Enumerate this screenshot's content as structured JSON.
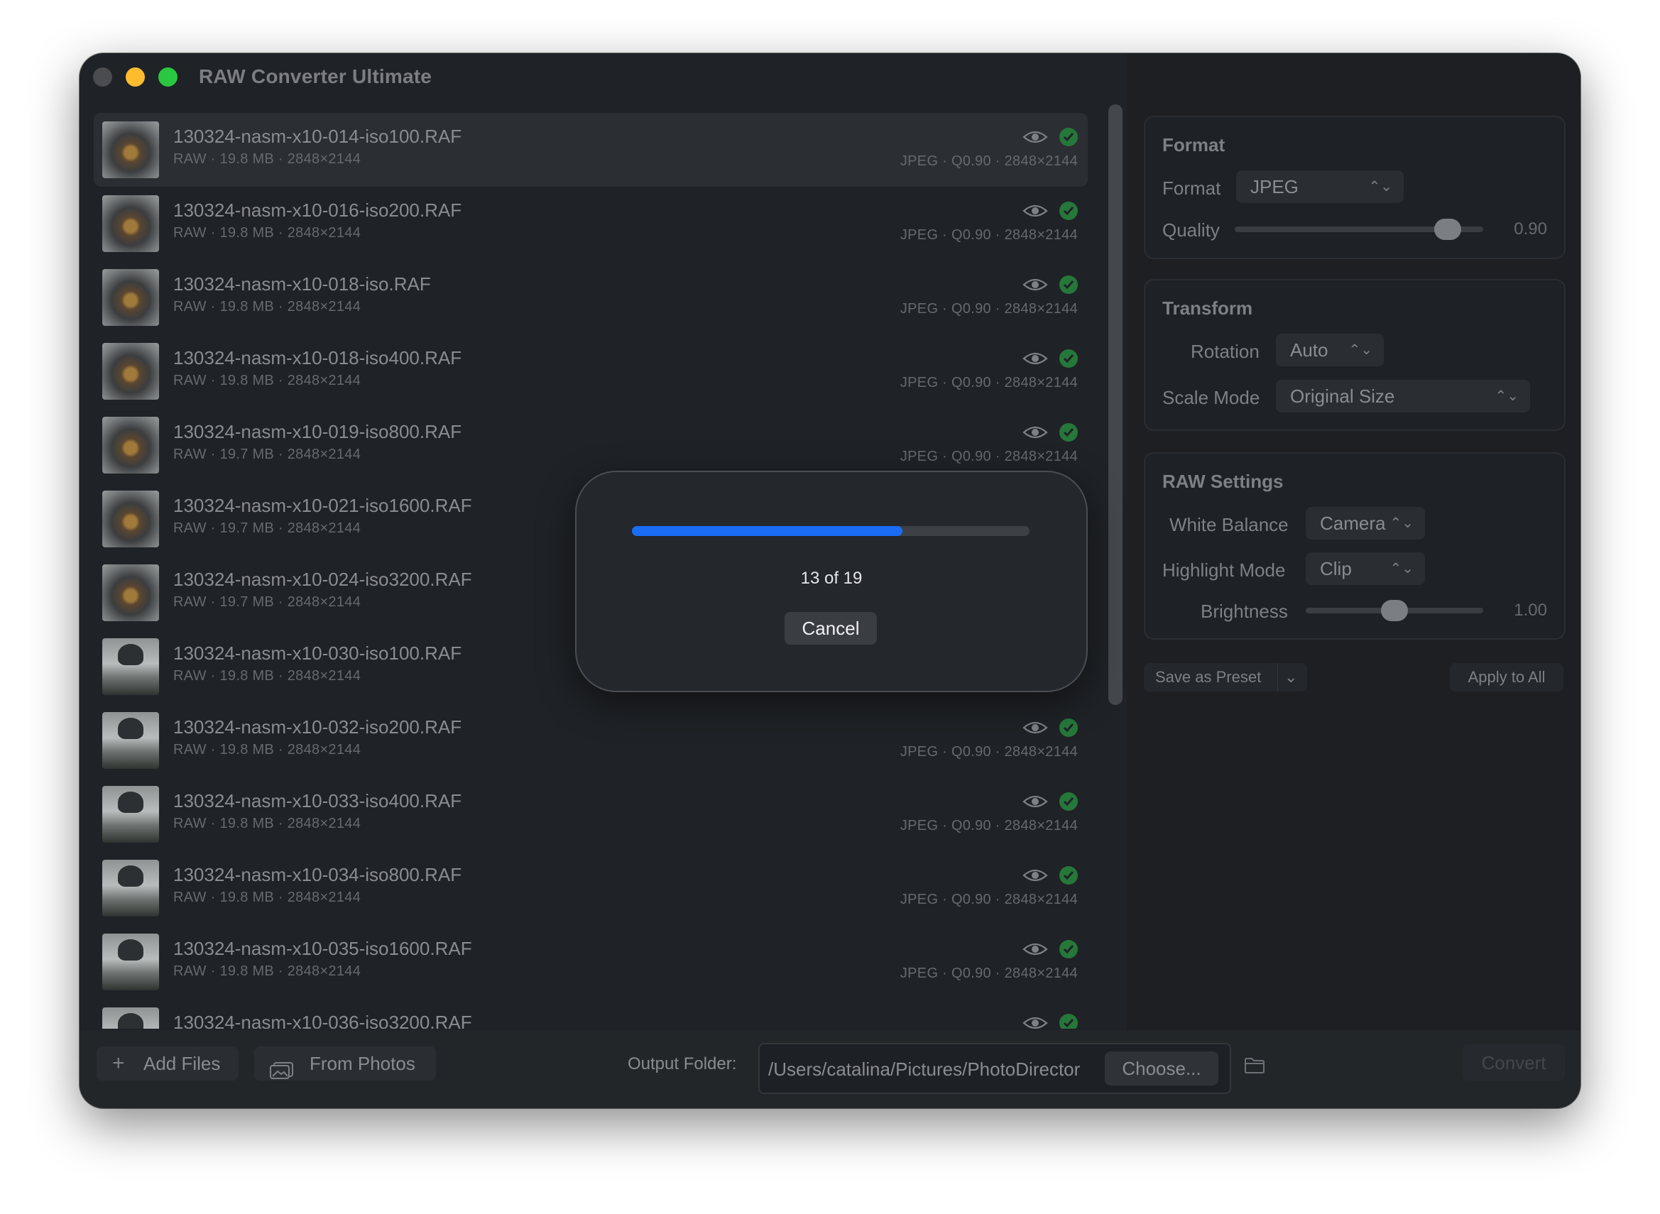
{
  "app": {
    "title": "RAW Converter Ultimate"
  },
  "files": [
    {
      "name": "130324-nasm-x10-014-iso100.RAF",
      "meta": "RAW · 19.8 MB · 2848×2144",
      "output": "JPEG · Q0.90 · 2848×2144",
      "thumb": "a"
    },
    {
      "name": "130324-nasm-x10-016-iso200.RAF",
      "meta": "RAW · 19.8 MB · 2848×2144",
      "output": "JPEG · Q0.90 · 2848×2144",
      "thumb": "a"
    },
    {
      "name": "130324-nasm-x10-018-iso.RAF",
      "meta": "RAW · 19.8 MB · 2848×2144",
      "output": "JPEG · Q0.90 · 2848×2144",
      "thumb": "a"
    },
    {
      "name": "130324-nasm-x10-018-iso400.RAF",
      "meta": "RAW · 19.8 MB · 2848×2144",
      "output": "JPEG · Q0.90 · 2848×2144",
      "thumb": "a"
    },
    {
      "name": "130324-nasm-x10-019-iso800.RAF",
      "meta": "RAW · 19.7 MB · 2848×2144",
      "output": "JPEG · Q0.90 · 2848×2144",
      "thumb": "a"
    },
    {
      "name": "130324-nasm-x10-021-iso1600.RAF",
      "meta": "RAW · 19.7 MB · 2848×2144",
      "output": "",
      "thumb": "a"
    },
    {
      "name": "130324-nasm-x10-024-iso3200.RAF",
      "meta": "RAW · 19.7 MB · 2848×2144",
      "output": "",
      "thumb": "a"
    },
    {
      "name": "130324-nasm-x10-030-iso100.RAF",
      "meta": "RAW · 19.8 MB · 2848×2144",
      "output": "",
      "thumb": "b"
    },
    {
      "name": "130324-nasm-x10-032-iso200.RAF",
      "meta": "RAW · 19.8 MB · 2848×2144",
      "output": "JPEG · Q0.90 · 2848×2144",
      "thumb": "b"
    },
    {
      "name": "130324-nasm-x10-033-iso400.RAF",
      "meta": "RAW · 19.8 MB · 2848×2144",
      "output": "JPEG · Q0.90 · 2848×2144",
      "thumb": "b"
    },
    {
      "name": "130324-nasm-x10-034-iso800.RAF",
      "meta": "RAW · 19.8 MB · 2848×2144",
      "output": "JPEG · Q0.90 · 2848×2144",
      "thumb": "b"
    },
    {
      "name": "130324-nasm-x10-035-iso1600.RAF",
      "meta": "RAW · 19.8 MB · 2848×2144",
      "output": "JPEG · Q0.90 · 2848×2144",
      "thumb": "b"
    },
    {
      "name": "130324-nasm-x10-036-iso3200.RAF",
      "meta": "",
      "output": "",
      "thumb": "b"
    }
  ],
  "progress": {
    "current": 13,
    "total": 19,
    "label": "13 of 19",
    "fraction": 0.68,
    "cancel_label": "Cancel"
  },
  "format_group": {
    "title": "Format",
    "format_label": "Format",
    "format_value": "JPEG",
    "quality_label": "Quality",
    "quality_value": "0.90",
    "quality_level": 0.9
  },
  "transform_group": {
    "title": "Transform",
    "rotation_label": "Rotation",
    "rotation_value": "Auto",
    "scale_label": "Scale Mode",
    "scale_value": "Original Size"
  },
  "raw_group": {
    "title": "RAW Settings",
    "wb_label": "White Balance",
    "wb_value": "Camera",
    "highlight_label": "Highlight Mode",
    "highlight_value": "Clip",
    "brightness_label": "Brightness",
    "brightness_value": "1.00",
    "brightness_level": 0.5
  },
  "preset": {
    "save_label": "Save as Preset",
    "apply_label": "Apply to All"
  },
  "footer": {
    "add_files": "Add Files",
    "from_photos": "From Photos",
    "output_label": "Output Folder:",
    "output_path": "/Users/catalina/Pictures/PhotoDirector",
    "choose": "Choose...",
    "convert": "Convert"
  },
  "colors": {
    "accent": "#1a6cf5",
    "success": "#26773a",
    "window_bg": "#1f2226"
  },
  "icons": {
    "preview": "eye-icon",
    "done": "checkmark-circle-icon",
    "add": "plus-icon",
    "photos": "photos-icon",
    "folder": "folder-icon"
  }
}
